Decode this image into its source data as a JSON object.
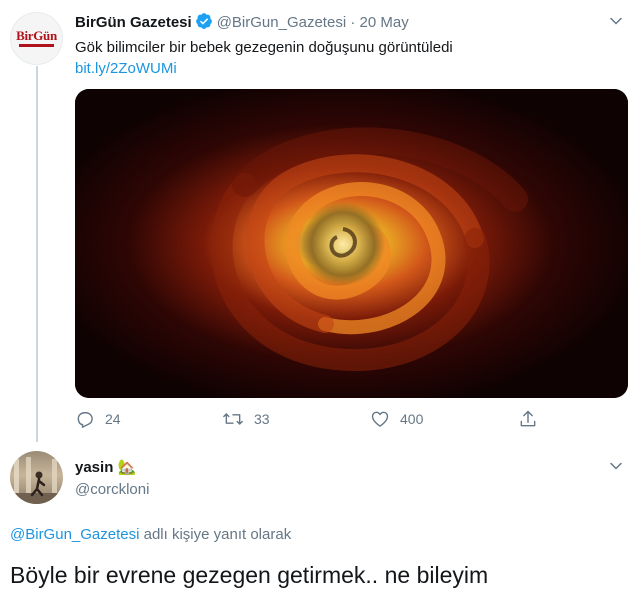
{
  "tweet": {
    "author_name": "BirGün Gazetesi",
    "handle": "@BirGun_Gazetesi",
    "separator": "·",
    "date": "20 May",
    "text": "Gök bilimciler bir bebek gezegenin doğuşunu görüntüledi",
    "link": "bit.ly/2ZoWUMi",
    "avatar_logo_text": "BirGün",
    "stats": {
      "replies": "24",
      "retweets": "33",
      "likes": "400"
    },
    "media_icon": "spiral-galaxy-image"
  },
  "reply": {
    "author_name": "yasin",
    "emoji": "🏡",
    "handle": "@corckloni",
    "context_mention": "@BirGun_Gazetesi",
    "context_suffix": " adlı kişiye yanıt olarak",
    "text": "Böyle bir evrene gezegen getirmek.. ne bileyim"
  },
  "colors": {
    "link": "#1b95e0",
    "muted": "#657786",
    "verified": "#1da1f2",
    "brand_red": "#b0121b"
  }
}
